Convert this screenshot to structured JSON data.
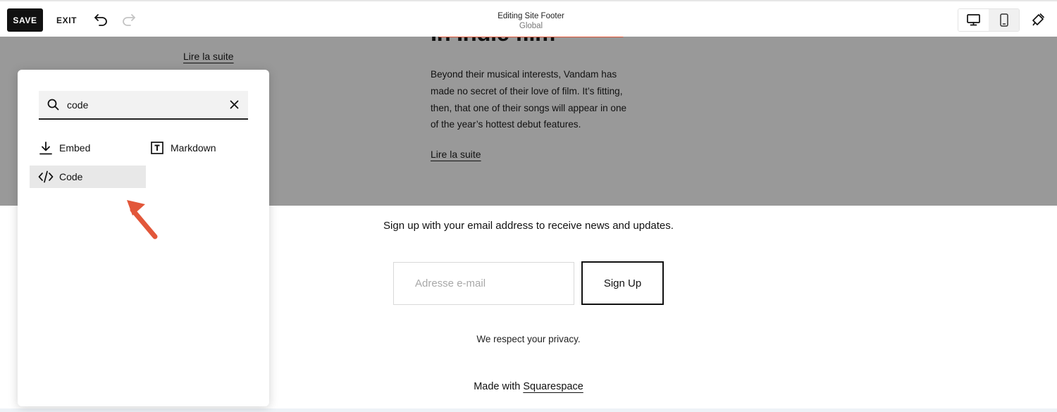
{
  "toolbar": {
    "save_label": "SAVE",
    "exit_label": "EXIT",
    "editing_title": "Editing Site Footer",
    "editing_subtitle": "Global",
    "highlight_color": "#e2573a"
  },
  "content": {
    "heading_fragment": "In Indie film",
    "left_read_more": "Lire la suite",
    "article_text": "Beyond their musical interests, Vandam has made no secret of their love of film. It’s fitting, then, that one of their songs will appear in one of the year’s hottest debut features.",
    "right_read_more": "Lire la suite"
  },
  "footer": {
    "signup_text": "Sign up with your email address to receive news and updates.",
    "email_placeholder": "Adresse e-mail",
    "signup_button": "Sign Up",
    "privacy_text": "We respect your privacy.",
    "made_with_prefix": "Made with",
    "made_with_link": "Squarespace"
  },
  "panel": {
    "search_value": "code",
    "results": [
      {
        "label": "Embed",
        "icon": "download-icon"
      },
      {
        "label": "Markdown",
        "icon": "markdown-icon"
      },
      {
        "label": "Code",
        "icon": "code-icon"
      }
    ]
  },
  "colors": {
    "gray_band": "#999999",
    "accent": "#e2573a"
  }
}
